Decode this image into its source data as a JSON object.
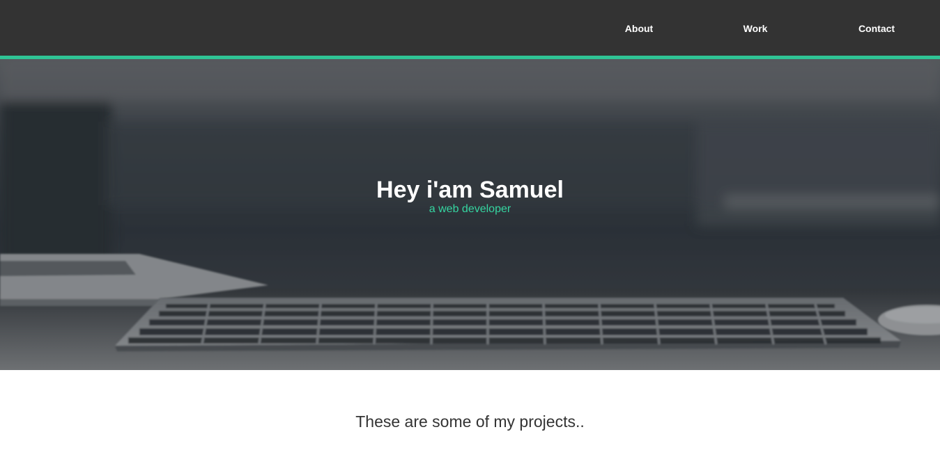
{
  "nav": {
    "about": "About",
    "work": "Work",
    "contact": "Contact"
  },
  "hero": {
    "title": "Hey i'am Samuel",
    "subtitle": "a web developer",
    "background_image": "keyboard-on-desk-photo"
  },
  "projects": {
    "heading": "These are some of my projects.."
  },
  "colors": {
    "navbar": "#333333",
    "accent": "#2fc495",
    "subtitle": "#35d6a1",
    "heading_text": "#333333"
  }
}
